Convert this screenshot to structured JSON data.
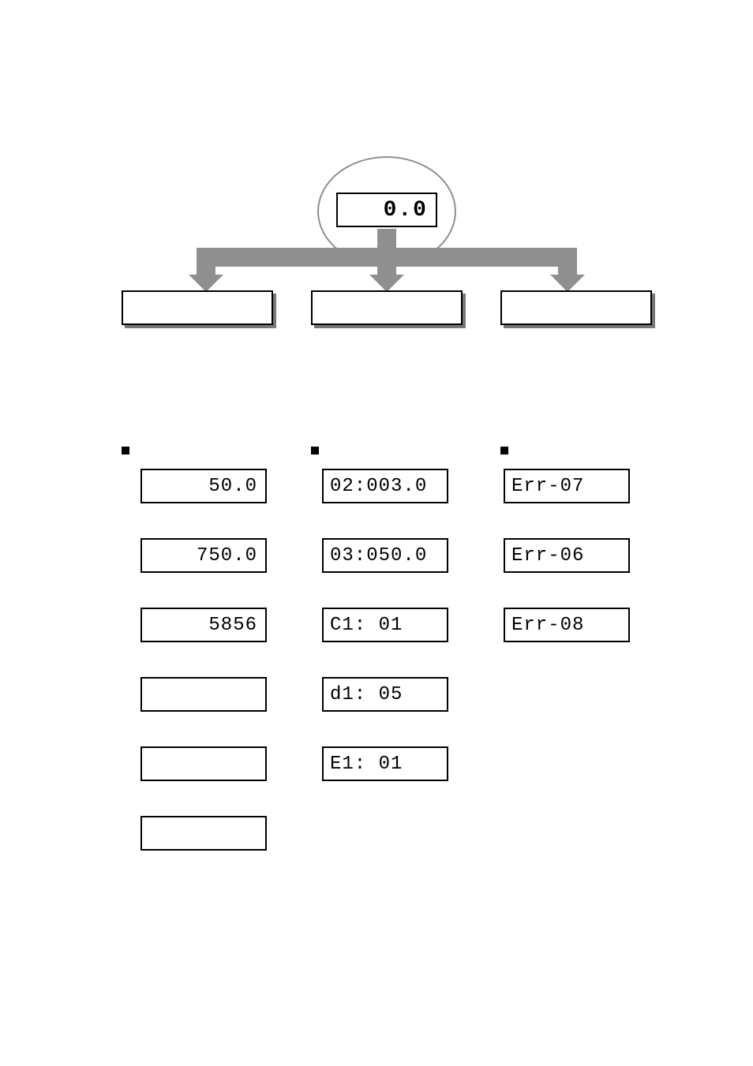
{
  "top_display": "0.0",
  "mode_boxes": {
    "left": "",
    "mid": "",
    "right": ""
  },
  "section_labels": {
    "left": "",
    "mid": "",
    "right": ""
  },
  "col_left_values": [
    "50.0",
    "750.0",
    "5856",
    "",
    "",
    ""
  ],
  "col_mid_values": [
    "02:003.0",
    "03:050.0",
    "C1:  01",
    "d1:  05",
    "E1:  01"
  ],
  "col_right_values": [
    "Err-07",
    "Err-06",
    "Err-08"
  ]
}
